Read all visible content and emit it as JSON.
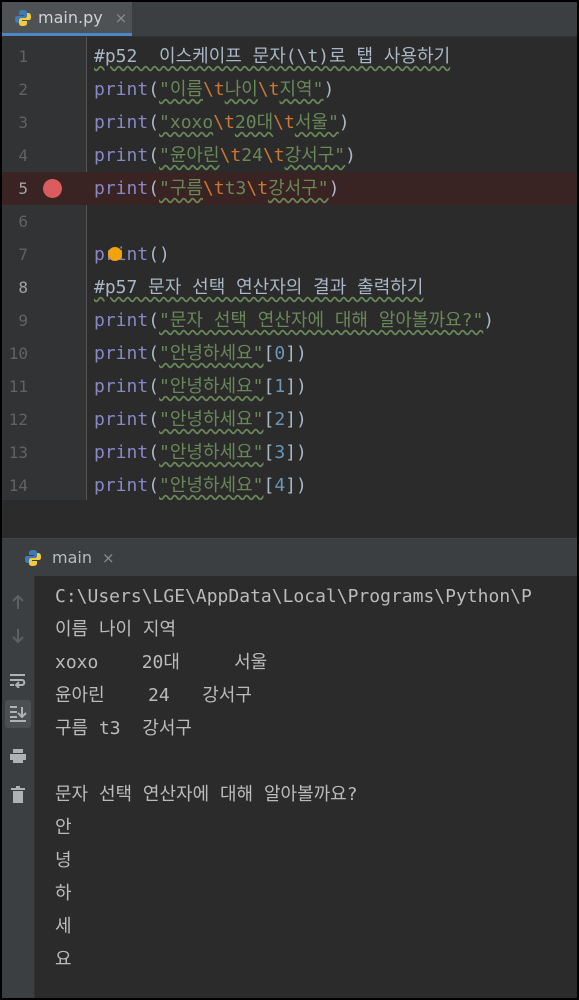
{
  "editor_tab": {
    "filename": "main.py",
    "close": "×"
  },
  "lines": [
    {
      "n": "1"
    },
    {
      "n": "2"
    },
    {
      "n": "3"
    },
    {
      "n": "4"
    },
    {
      "n": "5"
    },
    {
      "n": "6"
    },
    {
      "n": "7"
    },
    {
      "n": "8"
    },
    {
      "n": "9"
    },
    {
      "n": "10"
    },
    {
      "n": "11"
    },
    {
      "n": "12"
    },
    {
      "n": "13"
    },
    {
      "n": "14"
    }
  ],
  "code": {
    "l1": "#p52  이스케이프 문자(\\t)로 탭 사용하기",
    "l2_str1": "\"이름",
    "l2_str2": "나이",
    "l2_str3": "지역\"",
    "l3_str1": "\"xoxo",
    "l3_str2": "20대",
    "l3_str3": "서울\"",
    "l4_str1": "\"윤아린",
    "l4_str2": "24",
    "l4_str3": "강서구\"",
    "l5_str1": "\"구름",
    "l5_str2": "t3",
    "l5_str3": "강서구\"",
    "l8": "#p57 문자 선택 연산자의 결과 출력하기",
    "l9_str": "\"문자 선택 연산자에 대해 알아볼까요?\"",
    "hello": "\"안녕하세요\"",
    "print": "print",
    "esc": "\\t",
    "idx0": "0",
    "idx1": "1",
    "idx2": "2",
    "idx3": "3",
    "idx4": "4"
  },
  "run_tab": {
    "name": "main",
    "close": "×"
  },
  "console": [
    "C:\\Users\\LGE\\AppData\\Local\\Programs\\Python\\P",
    "이름 나이 지역",
    "xoxo    20대     서울",
    "윤아린    24   강서구",
    "구름 t3  강서구",
    "",
    "문자 선택 연산자에 대해 알아볼까요?",
    "안",
    "녕",
    "하",
    "세",
    "요"
  ],
  "toolbar_icons": [
    "arrow-up-icon",
    "arrow-down-icon",
    "soft-wrap-icon",
    "scroll-to-end-icon",
    "print-icon",
    "trash-icon"
  ],
  "colors": {
    "background": "#2b2b2b",
    "keyword": "#8888c6",
    "string": "#6a8759",
    "escape": "#cc7832",
    "number": "#6897bb",
    "comment": "#808080",
    "breakpoint": "#db5c5c"
  }
}
